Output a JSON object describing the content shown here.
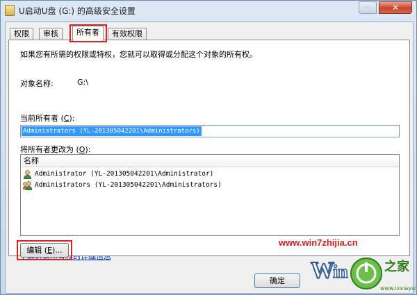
{
  "window": {
    "title": "U启动U盘 (G:) 的高级安全设置",
    "minimize_glyph": "▬",
    "close_glyph": "✕"
  },
  "tabs": [
    {
      "label": "权限",
      "active": false
    },
    {
      "label": "审核",
      "active": false
    },
    {
      "label": "所有者",
      "active": true
    },
    {
      "label": "有效权限",
      "active": false
    }
  ],
  "owner_tab": {
    "intro": "如果您有所需的权限或特权，您就可以取得或分配这个对象的所有权。",
    "object_name_label": "对象名称:",
    "object_name_value": "G:\\",
    "current_owner_label_pre": "当前所有者 (",
    "current_owner_label_key": "C",
    "current_owner_label_post": "):",
    "current_owner_value": "Administrators (YL-201305042201\\Administrators)",
    "change_owner_label_pre": "将所有者更改为 (",
    "change_owner_label_key": "O",
    "change_owner_label_post": "):",
    "list_header": "名称",
    "owners": [
      {
        "name": "Administrator (YL-201305042201\\Administrator)",
        "icon": "user-icon"
      },
      {
        "name": "Administrators (YL-201305042201\\Administrators)",
        "icon": "user-group-icon"
      }
    ],
    "edit_button_pre": "编辑 (",
    "edit_button_key": "E",
    "edit_button_post": ")..."
  },
  "footer": {
    "learn_more_link": "了解对象所有权的详细信息",
    "ok_button": "确定"
  },
  "watermark": {
    "url": "www.win7zhijia.cn",
    "logo_text": "Win7之家",
    "logo_site": "www.lxxiayuk.com"
  },
  "colors": {
    "highlight_box": "#e0201a",
    "selection": "#3399ff",
    "link": "#0033cc"
  }
}
